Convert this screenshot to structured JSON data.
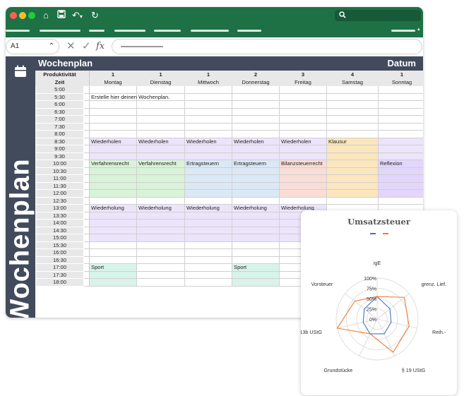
{
  "toolbar": {
    "home_icon": "home-icon",
    "save_icon": "save-icon",
    "undo_icon": "undo-icon",
    "redo_icon": "refresh-icon",
    "search_icon": "search-icon",
    "traffic_colors": [
      "#ff5f57",
      "#febc2e",
      "#28c840"
    ]
  },
  "formula_bar": {
    "cell_ref": "A1",
    "fx": "fx",
    "cancel": "✕",
    "enter": "✓"
  },
  "sheet": {
    "title": "Wochenplan",
    "date_label": "Datum",
    "side_title": "Wochenplan",
    "header_row1": [
      "Produktivität",
      "1",
      "1",
      "1",
      "2",
      "3",
      "4",
      "1"
    ],
    "header_row2": [
      "Zeit",
      "Montag",
      "Dienstag",
      "Mittwoch",
      "Donnerstag",
      "Freitag",
      "Samstag",
      "Sonntag"
    ],
    "rows": [
      {
        "time": "5:00",
        "cells": [
          "",
          "",
          "",
          "",
          "",
          "",
          ""
        ]
      },
      {
        "time": "5:30",
        "cells": [
          "Erstelle hier deinen Wochenplan.",
          "",
          "",
          "",
          "",
          "",
          ""
        ]
      },
      {
        "time": "6:00",
        "cells": [
          "",
          "",
          "",
          "",
          "",
          "",
          ""
        ]
      },
      {
        "time": "6:30",
        "cells": [
          "",
          "",
          "",
          "",
          "",
          "",
          ""
        ]
      },
      {
        "time": "7:00",
        "cells": [
          "",
          "",
          "",
          "",
          "",
          "",
          ""
        ]
      },
      {
        "time": "7:30",
        "cells": [
          "",
          "",
          "",
          "",
          "",
          "",
          ""
        ]
      },
      {
        "time": "8:00",
        "cells": [
          "",
          "",
          "",
          "",
          "",
          "",
          ""
        ]
      },
      {
        "time": "8:30",
        "cells": [
          "Wiederholen",
          "Wiederholen",
          "Wiederholen",
          "Wiederholen",
          "Wiederholen",
          "Klausur",
          ""
        ]
      },
      {
        "time": "9:00",
        "cells": [
          "",
          "",
          "",
          "",
          "",
          "",
          ""
        ]
      },
      {
        "time": "9:30",
        "cells": [
          "",
          "",
          "",
          "",
          "",
          "",
          ""
        ]
      },
      {
        "time": "10:00",
        "cells": [
          "Verfahrensrecht",
          "Verfahrensrecht",
          "Ertragsteuern",
          "Ertragsteuern",
          "Bilanzsteuerrecht",
          "",
          "Reflexion"
        ]
      },
      {
        "time": "10:30",
        "cells": [
          "",
          "",
          "",
          "",
          "",
          "",
          ""
        ]
      },
      {
        "time": "11:00",
        "cells": [
          "",
          "",
          "",
          "",
          "",
          "",
          ""
        ]
      },
      {
        "time": "11:30",
        "cells": [
          "",
          "",
          "",
          "",
          "",
          "",
          ""
        ]
      },
      {
        "time": "12:00",
        "cells": [
          "",
          "",
          "",
          "",
          "",
          "",
          ""
        ]
      },
      {
        "time": "12:30",
        "cells": [
          "",
          "",
          "",
          "",
          "",
          "",
          ""
        ]
      },
      {
        "time": "13:00",
        "cells": [
          "Wiederholung",
          "Wiederholung",
          "Wiederholung",
          "Wiederholung",
          "Wiederholung",
          "",
          ""
        ]
      },
      {
        "time": "13:30",
        "cells": [
          "",
          "",
          "",
          "",
          "",
          "",
          ""
        ]
      },
      {
        "time": "14:00",
        "cells": [
          "",
          "",
          "",
          "",
          "",
          "",
          ""
        ]
      },
      {
        "time": "14:30",
        "cells": [
          "",
          "",
          "",
          "",
          "",
          "",
          ""
        ]
      },
      {
        "time": "15:00",
        "cells": [
          "",
          "",
          "",
          "",
          "",
          "",
          ""
        ]
      },
      {
        "time": "15:30",
        "cells": [
          "",
          "",
          "",
          "",
          "",
          "",
          ""
        ]
      },
      {
        "time": "16:00",
        "cells": [
          "",
          "",
          "",
          "",
          "",
          "",
          ""
        ]
      },
      {
        "time": "16:30",
        "cells": [
          "",
          "",
          "",
          "",
          "",
          "",
          ""
        ]
      },
      {
        "time": "17:00",
        "cells": [
          "Sport",
          "",
          "",
          "Sport",
          "",
          "",
          ""
        ]
      },
      {
        "time": "17:30",
        "cells": [
          "",
          "",
          "",
          "",
          "",
          "",
          ""
        ]
      },
      {
        "time": "18:00",
        "cells": [
          "",
          "",
          "",
          "",
          "",
          "",
          ""
        ]
      }
    ],
    "colors": {
      "ribbon": "#1e7145",
      "sidebar": "#424b5c",
      "review": "#ece4fb",
      "procedure": "#d9f3d8",
      "income_tax": "#dbe8f6",
      "balance": "#f9ddd6",
      "exam": "#fbe6bd",
      "reflection": "#e2d6fb",
      "sport": "#d8f4ea"
    }
  },
  "chart_data": {
    "type": "radar",
    "title": "Umsatzsteuer",
    "axes": [
      "igE",
      "grenz. Lief.",
      "Reih.-",
      "§ 19 UStG",
      "Grundstücke",
      "§ 13b UStG",
      "Vorsteuer"
    ],
    "ticks": [
      "0%",
      "25%",
      "50%",
      "75%",
      "100%"
    ],
    "rmax": 100,
    "series": [
      {
        "color": "#4472c4",
        "values": [
          55,
          40,
          35,
          40,
          40,
          35,
          40
        ]
      },
      {
        "color": "#ed7d31",
        "values": [
          55,
          85,
          80,
          90,
          40,
          100,
          70
        ]
      }
    ],
    "legend_position": "top"
  }
}
